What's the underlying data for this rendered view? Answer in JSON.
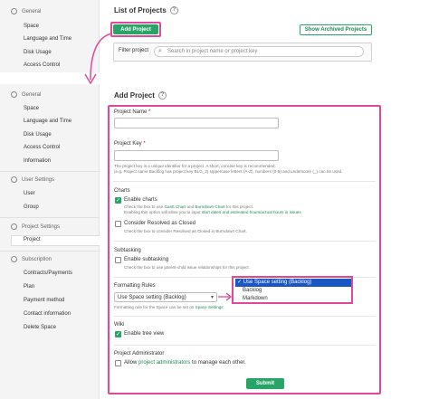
{
  "top": {
    "sidebar": {
      "general": "General",
      "items": [
        "Space",
        "Language and Time",
        "Disk Usage",
        "Access Control"
      ]
    },
    "title": "List of Projects",
    "help": "?",
    "add_button": "Add Project",
    "archived_button": "Show Archived Projects",
    "filter_label": "Filter project",
    "filter_placeholder": "Search in project name or project key"
  },
  "sidebar": {
    "general": "General",
    "general_items": [
      "Space",
      "Language and Time",
      "Disk Usage",
      "Access Control",
      "Information"
    ],
    "user_settings": "User Settings",
    "user_items": [
      "User",
      "Group"
    ],
    "project_settings": "Project Settings",
    "project_items": [
      "Project"
    ],
    "subscription": "Subscription",
    "subscription_items": [
      "Contracts/Payments",
      "Plan",
      "Payment method",
      "Contact information",
      "Delete Space"
    ]
  },
  "form": {
    "title": "Add Project",
    "help": "?",
    "project_name_label": "Project Name",
    "project_key_label": "Project Key",
    "required_mark": "*",
    "key_help_1": "The project key is a unique identifier for a project. A short, concise key is recommended.",
    "key_help_2": "(e.g. Project name Backlog has project key BLG_2) Uppercase letters (A-Z), numbers (0-9) and underscore (_) can be used.",
    "charts_section": "Charts",
    "enable_charts": "Enable charts",
    "charts_help_pre": "Check the box to use",
    "gantt_chart": "Gantt Chart",
    "charts_help_and": "and",
    "burndown_chart": "Burndown Chart",
    "charts_help_post": "for this project.",
    "charts_help_2_pre": "Enabling this option will allow you to input",
    "charts_help_2_link": "start dates and estimated hours/actual hours in issues",
    "consider_resolved": "Consider Resolved as Closed",
    "consider_help": "Check the box to consider Resolved as Closed in Burndown Chart.",
    "subtasking_section": "Subtasking",
    "enable_subtasking": "Enable subtasking",
    "subtasking_help": "Check the box to use parent-child issue relationships for this project.",
    "formatting_section": "Formatting Rules",
    "formatting_value": "Use Space setting (Backlog)",
    "formatting_help_pre": "Formatting rule for the Space can be set on",
    "formatting_help_link": "Space Settings",
    "dropdown_options": [
      "Use Space setting (Backlog)",
      "Backlog",
      "Markdown"
    ],
    "wiki_section": "Wiki",
    "enable_tree": "Enable tree view",
    "admin_section": "Project Administrator",
    "admin_allow": "Allow",
    "admin_link": "project administrators",
    "admin_post": "to manage each other.",
    "submit": "Submit"
  }
}
